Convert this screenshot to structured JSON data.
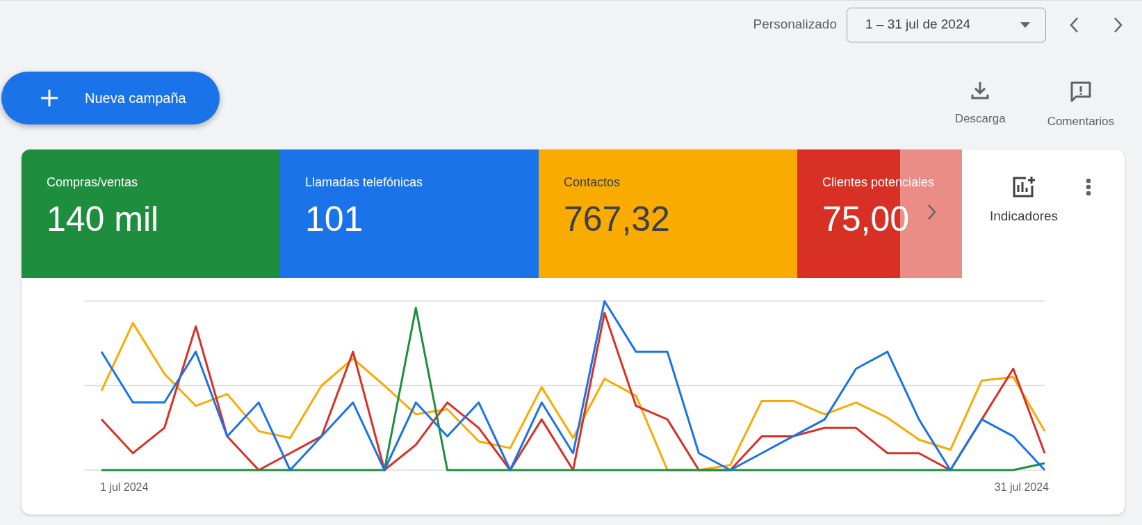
{
  "toolbar": {
    "preset_label": "Personalizado",
    "date_range": "1 – 31 jul de 2024"
  },
  "new_campaign_button": "Nueva campaña",
  "actions": [
    "Descarga",
    "Comentarios"
  ],
  "metrics": [
    {
      "label": "Compras/ventas",
      "value": "140 mil",
      "color": "#1e8e3e"
    },
    {
      "label": "Llamadas telefónicas",
      "value": "101",
      "color": "#1a73e8"
    },
    {
      "label": "Contactos",
      "value": "767,32",
      "color": "#f9ab00"
    },
    {
      "label": "Clientes potenciales",
      "value": "75,00",
      "color": "#d93025"
    }
  ],
  "metrics_panel": {
    "label": "Indicadores"
  },
  "chart": {
    "start_label": "1 jul 2024",
    "end_label": "31 jul 2024"
  }
}
